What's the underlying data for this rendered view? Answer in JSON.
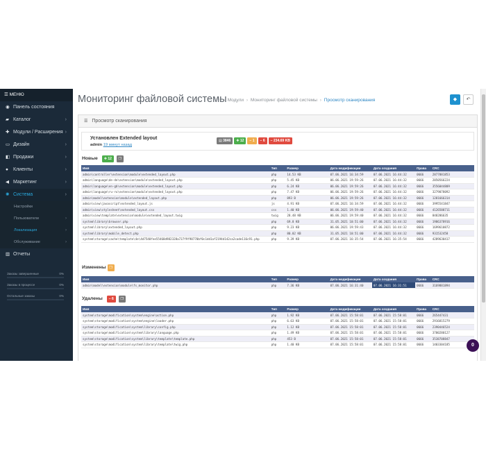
{
  "sidebar": {
    "menu_label": "МЕНЮ",
    "items": [
      {
        "icon": "dashboard-icon",
        "glyph": "◉",
        "label": "Панель состояния",
        "has_children": false
      },
      {
        "icon": "tag-icon",
        "glyph": "▰",
        "label": "Каталог",
        "has_children": true
      },
      {
        "icon": "puzzle-icon",
        "glyph": "✚",
        "label": "Модули / Расширения",
        "has_children": true
      },
      {
        "icon": "desktop-icon",
        "glyph": "▭",
        "label": "Дизайн",
        "has_children": true
      },
      {
        "icon": "cart-icon",
        "glyph": "◧",
        "label": "Продажи",
        "has_children": true
      },
      {
        "icon": "user-icon",
        "glyph": "●",
        "label": "Клиенты",
        "has_children": true
      },
      {
        "icon": "share-icon",
        "glyph": "◀",
        "label": "Маркетинг",
        "has_children": true
      },
      {
        "icon": "gear-icon",
        "glyph": "✺",
        "label": "Система",
        "has_children": true,
        "active": true
      }
    ],
    "sub_items": [
      {
        "label": "Настройки",
        "has_children": false
      },
      {
        "label": "Пользователи",
        "has_children": true
      },
      {
        "label": "Локализация",
        "has_children": true,
        "active": true
      },
      {
        "label": "Обслуживание",
        "has_children": true
      }
    ],
    "reports": {
      "icon": "bar-chart-icon",
      "glyph": "▥",
      "label": "Отчеты"
    },
    "stats": [
      {
        "label": "Заказы завершенные",
        "percent": "0%",
        "value": 0
      },
      {
        "label": "Заказы в процессе",
        "percent": "0%",
        "value": 0
      },
      {
        "label": "Остальные заказы",
        "percent": "0%",
        "value": 0
      }
    ]
  },
  "header": {
    "title": "Мониторинг файловой системы",
    "breadcrumb_home_icon": "⌂",
    "breadcrumbs": [
      "Модули",
      "Мониторинг файловой системы",
      "Просмотр сканирования"
    ],
    "save_icon": "◆",
    "back_icon": "↶"
  },
  "panel": {
    "title": "Просмотр сканирования",
    "title_icon": "☰",
    "install": {
      "title": "Установлен Extended layout",
      "user": "admin",
      "time": "19 минут назад",
      "badges": [
        {
          "label": "3846",
          "color": "#7a7a7a",
          "icon": "file-icon"
        },
        {
          "label": "12",
          "color": "#4cae4c",
          "icon": "plus-icon"
        },
        {
          "label": "1",
          "color": "#f0ad4e",
          "icon": "minus-icon"
        },
        {
          "label": "6",
          "color": "#e04a3f",
          "icon": "minus-icon"
        },
        {
          "label": "234.69 KB",
          "color": "#e04a3f",
          "icon": "minus-icon"
        }
      ]
    },
    "columns": [
      "Имя",
      "Тип",
      "Размер",
      "Дата модификации",
      "Дата создания",
      "Права",
      "CRC"
    ],
    "sections": {
      "new": {
        "label": "Новые",
        "count": "12",
        "rows": [
          [
            "admin\\controller\\extension\\module\\extended_layout.php",
            "php",
            "14.53 KB",
            "07.06.2021 16:34:59",
            "07.06.2021 16:44:32",
            "0666",
            "2877881853"
          ],
          [
            "admin\\language\\de-de\\extension\\module\\extended_layout.php",
            "php",
            "5.45 KB",
            "06.06.2021 19:59:26",
            "07.06.2021 16:44:32",
            "0666",
            "2050566224"
          ],
          [
            "admin\\language\\en-gb\\extension\\module\\extended_layout.php",
            "php",
            "6.24 KB",
            "06.06.2021 19:59:26",
            "07.06.2021 16:44:32",
            "0666",
            "3556044809"
          ],
          [
            "admin\\language\\ru-ru\\extension\\module\\extended_layout.php",
            "php",
            "7.47 KB",
            "06.06.2021 19:59:26",
            "07.06.2021 16:44:32",
            "0666",
            "3279078092"
          ],
          [
            "admin\\model\\extension\\module\\extended_layout.php",
            "php",
            "893 B",
            "06.06.2021 19:59:26",
            "07.06.2021 16:44:32",
            "0666",
            "1281666314"
          ],
          [
            "admin\\view\\javascript\\extended_layout.js",
            "js",
            "4.91 KB",
            "07.06.2021 16:34:59",
            "07.06.2021 16:44:32",
            "0666",
            "3995541847"
          ],
          [
            "admin\\view\\stylesheet\\extended_layout.css",
            "css",
            "1.40 KB",
            "06.06.2021 19:59:40",
            "07.06.2021 16:44:32",
            "0666",
            "4126588711"
          ],
          [
            "admin\\view\\template\\extension\\module\\extended_layout.twig",
            "twig",
            "28.48 KB",
            "06.06.2021 19:59:40",
            "07.06.2021 16:44:32",
            "0666",
            "848286635"
          ],
          [
            "system\\library\\browser.php",
            "php",
            "69.8 KB",
            "31.05.2021 10:51:00",
            "07.06.2021 16:44:32",
            "0666",
            "1986378916"
          ],
          [
            "system\\library\\extended_layout.php",
            "php",
            "9.23 KB",
            "06.06.2021 19:59:43",
            "07.06.2021 16:44:32",
            "0666",
            "1699610872"
          ],
          [
            "system\\library\\mobile_detect.php",
            "php",
            "80.02 KB",
            "31.05.2021 10:51:00",
            "07.06.2021 16:44:32",
            "0666",
            "931532458"
          ],
          [
            "system\\storage\\cache\\template\\4e\\4d7540fee55468d982328a737f9f98770bf0c1dd1af2194d142ca2cade116c91.php",
            "php",
            "9.39 KB",
            "07.06.2021 16:35:54",
            "07.06.2021 16:35:54",
            "0666",
            "4289630417"
          ]
        ]
      },
      "changed": {
        "label": "Изменены",
        "count": "1",
        "rows": [
          [
            "admin\\model\\extension\\module\\fs_monitor.php",
            "php",
            "7.36 KB",
            "07.06.2021 16:31:40",
            "07.06.2021 16:31:51",
            "0666",
            "3169881894"
          ]
        ]
      },
      "deleted": {
        "label": "Удалены",
        "count": "6",
        "rows": [
          [
            "system\\storage\\modification\\system\\engine\\action.php",
            "php",
            "1.92 KB",
            "07.06.2021 15:58:01",
            "07.06.2021 15:58:01",
            "0666",
            "265447431"
          ],
          [
            "system\\storage\\modification\\system\\engine\\loader.php",
            "php",
            "6.63 KB",
            "07.06.2021 15:58:01",
            "07.06.2021 15:58:01",
            "0666",
            "2916815279"
          ],
          [
            "system\\storage\\modification\\system\\library\\config.php",
            "php",
            "1.12 KB",
            "07.06.2021 15:58:01",
            "07.06.2021 15:58:01",
            "0666",
            "2390446524"
          ],
          [
            "system\\storage\\modification\\system\\library\\language.php",
            "php",
            "1.49 KB",
            "07.06.2021 15:58:01",
            "07.06.2021 15:58:01",
            "0666",
            "3700280127"
          ],
          [
            "system\\storage\\modification\\system\\library\\template\\template.php",
            "php",
            "453 B",
            "07.06.2021 15:58:01",
            "07.06.2021 15:58:01",
            "0666",
            "3538708847"
          ],
          [
            "system\\storage\\modification\\system\\library\\template\\twig.php",
            "php",
            "1.40 KB",
            "07.06.2021 15:58:01",
            "07.06.2021 15:58:01",
            "0666",
            "1403304185"
          ]
        ]
      }
    }
  },
  "chat_bubble": "0"
}
